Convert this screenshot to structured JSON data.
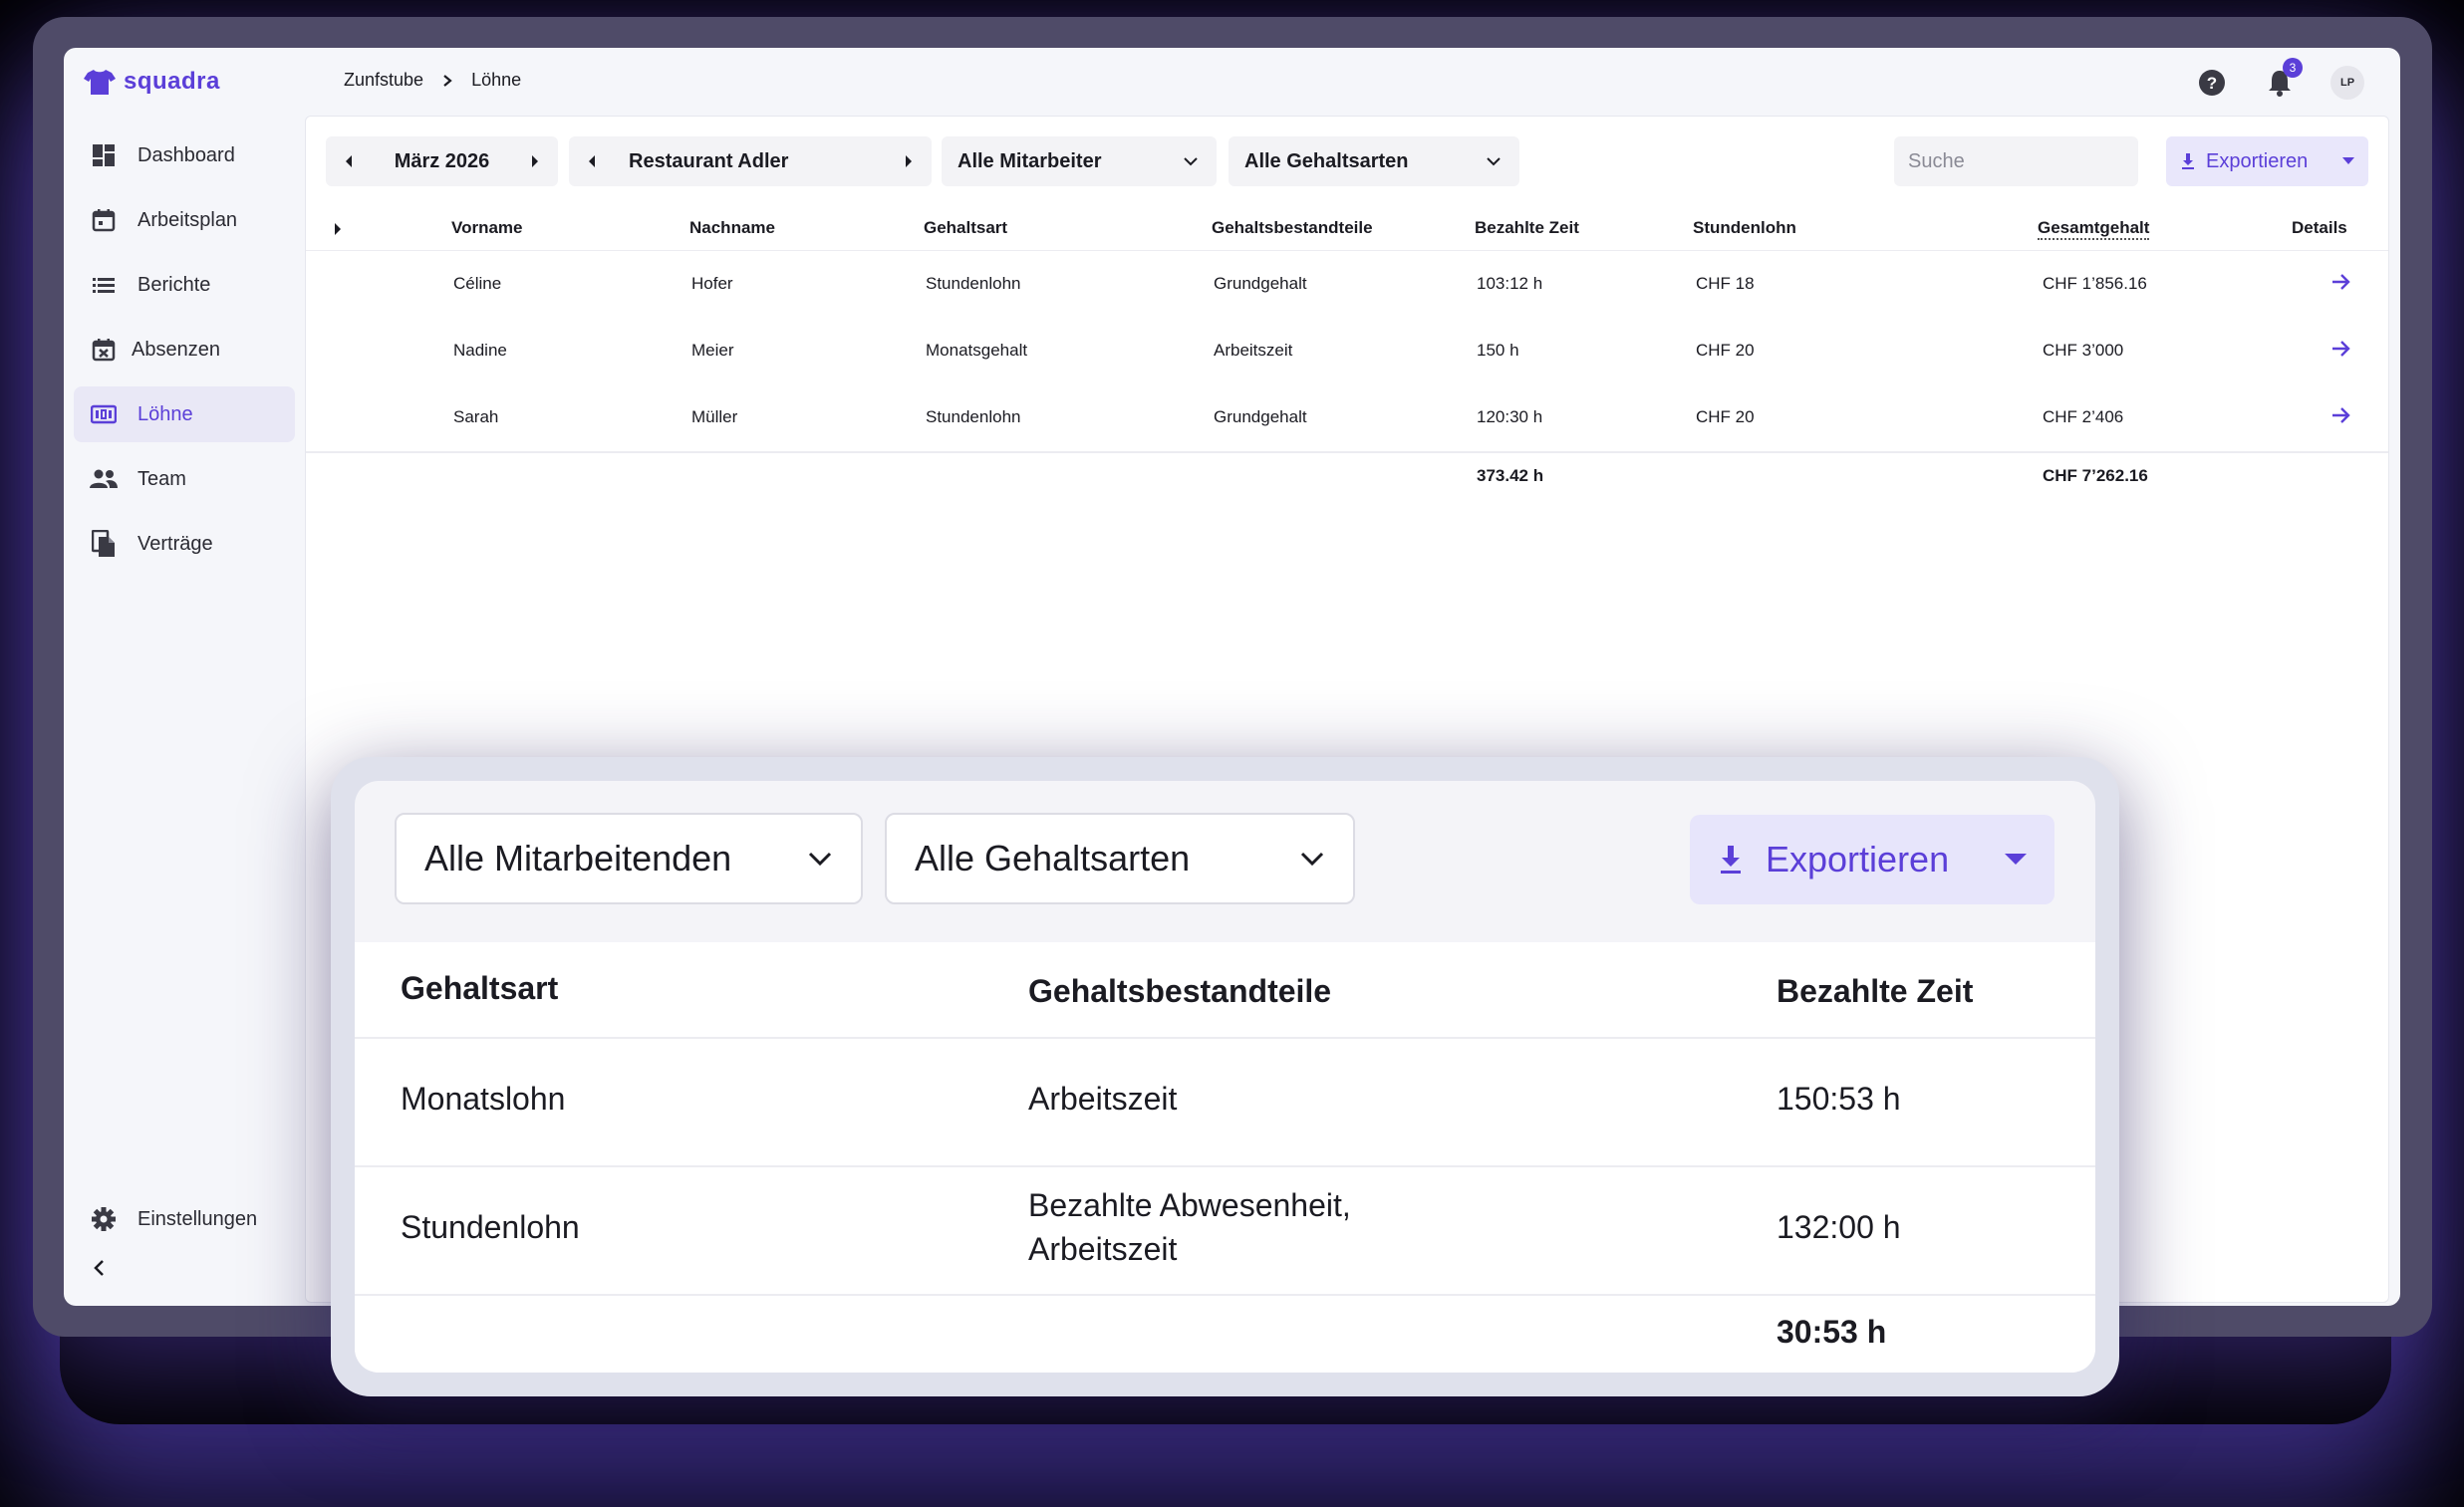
{
  "app": {
    "logo": "squadra"
  },
  "breadcrumb": {
    "parent": "Zunfstube",
    "current": "Löhne"
  },
  "header": {
    "notification_count": "3",
    "avatar_initials": "LP"
  },
  "sidebar": {
    "items": [
      {
        "label": "Dashboard",
        "icon": "dashboard-icon"
      },
      {
        "label": "Arbeitsplan",
        "icon": "calendar-icon"
      },
      {
        "label": "Berichte",
        "icon": "list-icon"
      },
      {
        "label": "Absenzen",
        "icon": "calendar-x-icon"
      },
      {
        "label": "Löhne",
        "icon": "money-icon",
        "active": true
      },
      {
        "label": "Team",
        "icon": "people-icon"
      },
      {
        "label": "Verträge",
        "icon": "documents-icon"
      }
    ],
    "settings_label": "Einstellungen"
  },
  "toolbar": {
    "month": "März 2026",
    "location": "Restaurant Adler",
    "employees": "Alle Mitarbeiter",
    "salary_types": "Alle Gehaltsarten",
    "search_placeholder": "Suche",
    "export_label": "Exportieren"
  },
  "table": {
    "columns": [
      "Vorname",
      "Nachname",
      "Gehaltsart",
      "Gehaltsbestandteile",
      "Bezahlte Zeit",
      "Stundenlohn",
      "Gesamtgehalt",
      "Details"
    ],
    "rows": [
      {
        "vorname": "Céline",
        "nachname": "Hofer",
        "gehaltsart": "Stundenlohn",
        "bestandteile": "Grundgehalt",
        "zeit": "103:12 h",
        "stundenlohn": "CHF 18",
        "gesamt": "CHF 1’856.16"
      },
      {
        "vorname": "Nadine",
        "nachname": "Meier",
        "gehaltsart": "Monatsgehalt",
        "bestandteile": "Arbeitszeit",
        "zeit": "150 h",
        "stundenlohn": "CHF 20",
        "gesamt": "CHF 3’000"
      },
      {
        "vorname": "Sarah",
        "nachname": "Müller",
        "gehaltsart": "Stundenlohn",
        "bestandteile": "Grundgehalt",
        "zeit": "120:30 h",
        "stundenlohn": "CHF 20",
        "gesamt": "CHF 2’406"
      }
    ],
    "totals": {
      "zeit": "373.42 h",
      "gesamt": "CHF 7’262.16"
    }
  },
  "zoom": {
    "employees": "Alle Mitarbeitenden",
    "salary_types": "Alle Gehaltsarten",
    "export_label": "Exportieren",
    "columns": [
      "Gehaltsart",
      "Gehaltsbestandteile",
      "Bezahlte Zeit"
    ],
    "rows": [
      {
        "gehaltsart": "Monatslohn",
        "bestandteile_1": "Arbeitszeit",
        "bestandteile_2": "",
        "zeit": "150:53 h"
      },
      {
        "gehaltsart": "Stundenlohn",
        "bestandteile_1": "Bezahlte Abwesenheit,",
        "bestandteile_2": "Arbeitszeit",
        "zeit": "132:00 h"
      }
    ],
    "total": "30:53 h"
  },
  "colors": {
    "accent": "#5b3fd8",
    "frame": "#4f4b68",
    "active_bg": "#e9e8f6"
  }
}
